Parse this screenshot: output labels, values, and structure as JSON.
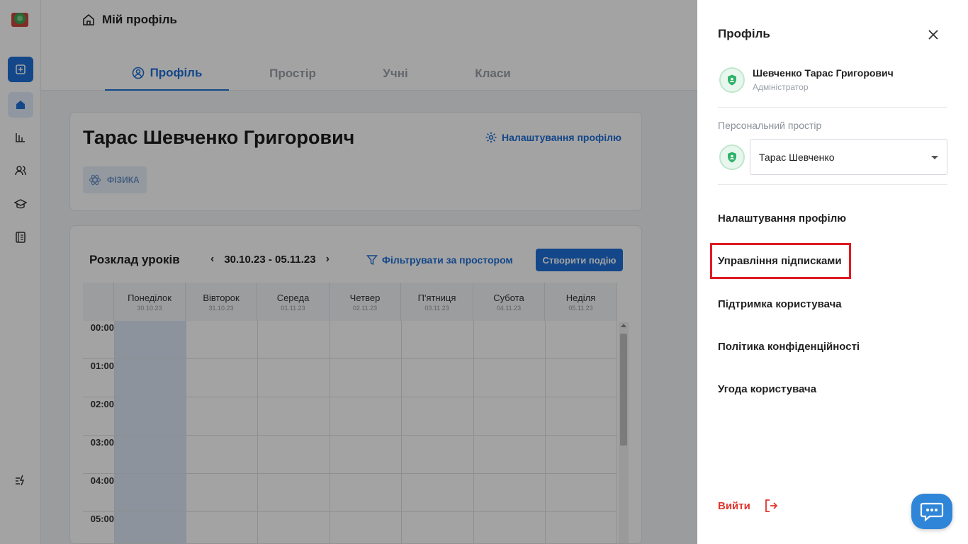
{
  "breadcrumb": {
    "title": "Мій профіль"
  },
  "tabs": [
    "Профіль",
    "Простір",
    "Учні",
    "Класи"
  ],
  "profile": {
    "full_name": "Тарас Шевченко Григорович",
    "settings_label": "Налаштування профілю",
    "subject": "ФІЗИКА"
  },
  "schedule": {
    "title": "Розклад уроків",
    "week_range": "30.10.23 - 05.11.23",
    "filter_label": "Фільтрувати за простором",
    "create_label": "Створити подію",
    "days": [
      {
        "name": "Понеділок",
        "date": "30.10.23"
      },
      {
        "name": "Вівторок",
        "date": "31.10.23"
      },
      {
        "name": "Середа",
        "date": "01.11.23"
      },
      {
        "name": "Четвер",
        "date": "02.11.23"
      },
      {
        "name": "П'ятниця",
        "date": "03.11.23"
      },
      {
        "name": "Субота",
        "date": "04.11.23"
      },
      {
        "name": "Неділя",
        "date": "05.11.23"
      }
    ],
    "hours": [
      "00:00",
      "01:00",
      "02:00",
      "03:00",
      "04:00",
      "05:00"
    ]
  },
  "drawer": {
    "title": "Профіль",
    "user_name": "Шевченко Тарас Григорович",
    "user_role": "Адміністратор",
    "personal_space_label": "Персональний простір",
    "personal_space_value": "Тарас Шевченко",
    "menu": [
      "Налаштування профілю",
      "Управління підписками",
      "Підтримка користувача",
      "Політика конфіденційності",
      "Угода користувача"
    ],
    "logout_label": "Вийти"
  },
  "colors": {
    "accent": "#1f6fd6",
    "danger": "#e0352b",
    "highlight": "#e01a22",
    "success": "#2fb36b"
  }
}
